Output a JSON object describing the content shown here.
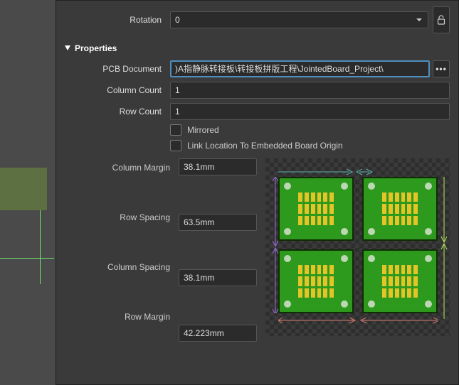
{
  "rotation": {
    "label": "Rotation",
    "value": "0"
  },
  "section": "Properties",
  "pcbDoc": {
    "label": "PCB Document",
    "value": ")A指静脉转接板\\转接板拼版工程\\JointedBoard_Project\\"
  },
  "columnCount": {
    "label": "Column Count",
    "value": "1"
  },
  "rowCount": {
    "label": "Row Count",
    "value": "1"
  },
  "mirrored": {
    "label": "Mirrored"
  },
  "linkLoc": {
    "label": "Link Location To Embedded Board Origin"
  },
  "columnMargin": {
    "label": "Column Margin",
    "value": "38.1mm"
  },
  "rowSpacing": {
    "label": "Row Spacing",
    "value": "63.5mm"
  },
  "columnSpacing": {
    "label": "Column Spacing",
    "value": "38.1mm"
  },
  "rowMargin": {
    "label": "Row Margin",
    "value": "42.223mm"
  },
  "colors": {
    "arrowColMargin": "#5bb0a8",
    "arrowRowSpacing": "#9a6ed4",
    "arrowColSpacing": "#d47b6e",
    "arrowRowMargin": "#b7e85a"
  }
}
